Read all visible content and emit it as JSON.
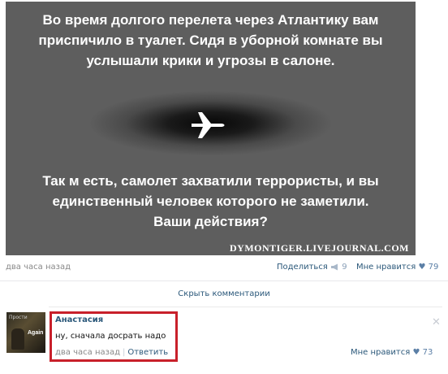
{
  "post": {
    "image": {
      "top_text": "Во время долгого перелета через Атлантику вам\nприспичило в туалет. Сидя в уборной комнате вы\nуслышали крики и угрозы в салоне.",
      "bottom_text": "Так м есть, самолет захватили террористы, и вы\nединственный человек которого не заметили.\nВаши действия?",
      "watermark": "DYMONTIGER.LIVEJOURNAL.COM",
      "icon": "airplane-icon"
    },
    "time": "два часа назад",
    "share_label": "Поделиться",
    "share_count": "9",
    "like_label": "Мне нравится",
    "like_count": "79"
  },
  "comments_toggle": "Скрыть комментарии",
  "comment": {
    "author": "Анастасия",
    "text": "ну, сначала досрать надо",
    "time": "два часа назад",
    "reply_label": "Ответить",
    "like_label": "Мне нравится",
    "like_count": "73",
    "avatar_text": "Again",
    "avatar_caption": "Прости"
  },
  "colors": {
    "link": "#2b587a",
    "highlight": "#c8202a",
    "heart": "#5b7fa6"
  }
}
